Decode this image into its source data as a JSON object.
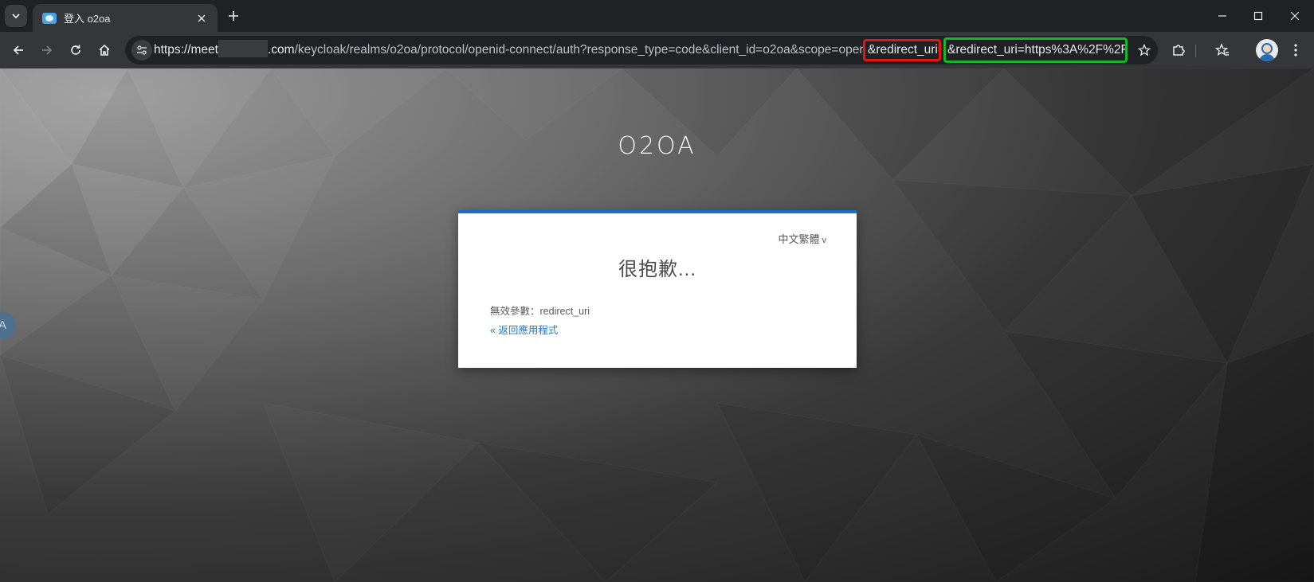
{
  "browser": {
    "tab": {
      "title": "登入 o2oa"
    },
    "address_bar": {
      "url_prefix": "https://meet",
      "url_host_suffix": ".com",
      "url_path": "/keycloak/realms/o2oa/protocol/openid-connect/auth?response_type=code&client_id=o2oa&scope=openid",
      "highlight_red": "&redirect_uri=",
      "highlight_green": "&redirect_uri=https%3A%2F%2F..."
    },
    "colors": {
      "highlight_red": "#e51515",
      "highlight_green": "#18b42b",
      "card_accent": "#1a6fc9",
      "link": "#1f7ac3"
    }
  },
  "page": {
    "brand": "O2OA",
    "language_selector": "中文繁體",
    "error_title": "很抱歉...",
    "error_message": "無效參數：redirect_uri",
    "back_link": "« 返回應用程式",
    "side_bubble": "A"
  }
}
